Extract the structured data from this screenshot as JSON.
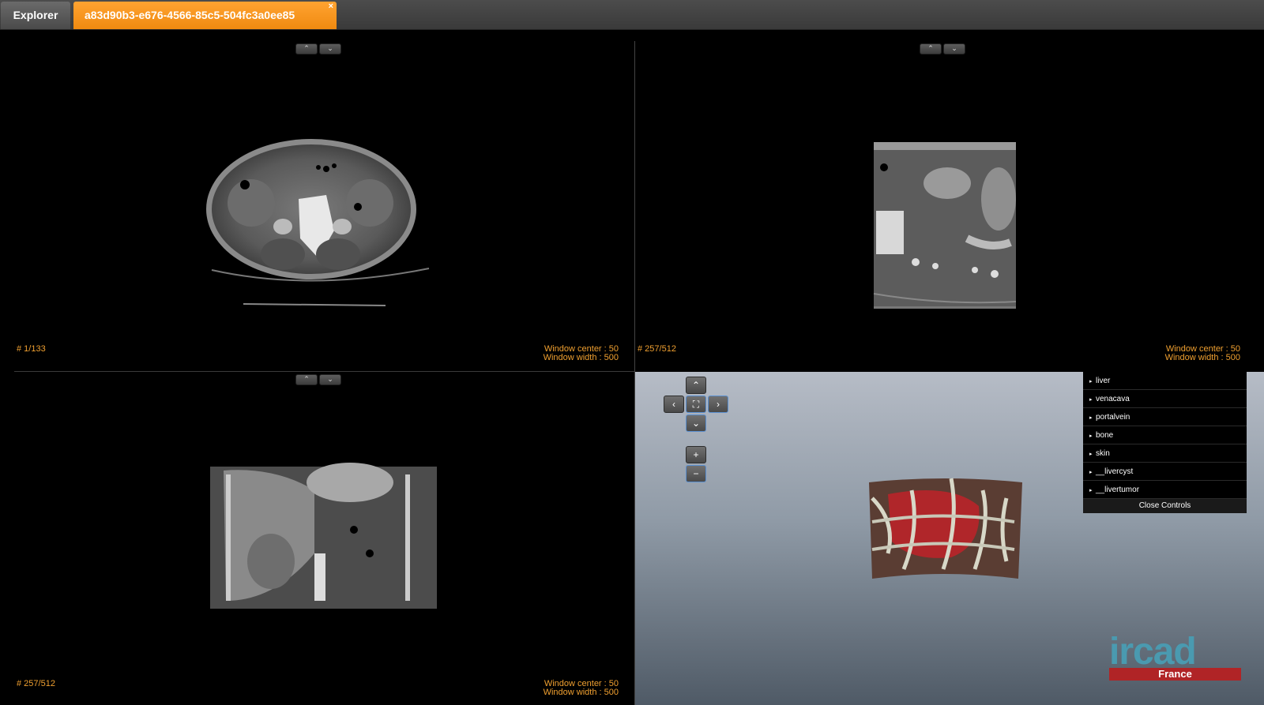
{
  "tabs": {
    "explorer_label": "Explorer",
    "study_label": "a83d90b3-e676-4566-85c5-504fc3a0ee85",
    "close_glyph": "×"
  },
  "scroll_buttons": {
    "up_glyph": "⌃",
    "down_glyph": "⌄"
  },
  "viewports": {
    "axial": {
      "slice": "# 1/133",
      "window_center": "Window center : 50",
      "window_width": "Window width : 500"
    },
    "sagittal": {
      "slice": "# 257/512",
      "window_center": "Window center : 50",
      "window_width": "Window width : 500"
    },
    "coronal": {
      "slice": "# 257/512",
      "window_center": "Window center : 50",
      "window_width": "Window width : 500"
    }
  },
  "nav": {
    "up": "⌃",
    "down": "⌄",
    "left": "‹",
    "right": "›",
    "center": "⛶",
    "zoom_in": "+",
    "zoom_out": "−"
  },
  "controls": {
    "items": [
      "liver",
      "venacava",
      "portalvein",
      "bone",
      "skin",
      "__livercyst",
      "__livertumor"
    ],
    "close_label": "Close Controls"
  },
  "logo": {
    "word": "ircad",
    "country": "France"
  },
  "colors": {
    "accent": "#f0a030",
    "tab_active": "#f59a22",
    "logo_bar": "#b02426",
    "logo_text": "#4a9ab0"
  }
}
